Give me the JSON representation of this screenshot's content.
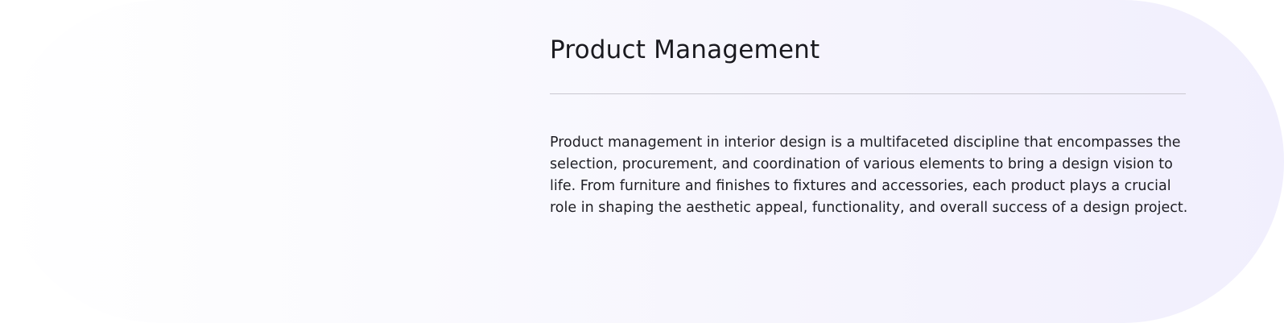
{
  "section": {
    "title": "Product Management",
    "description": "Product management in interior design is a multifaceted discipline that encompasses the selection, procurement, and coordination of various elements to bring a design vision to life. From furniture and finishes to fixtures and accessories, each product plays a crucial role in shaping the aesthetic appeal, functionality, and overall success of a design project."
  },
  "colors": {
    "background_start": "#ffffff",
    "background_end": "#f1effd",
    "text": "#1a1a1f",
    "divider": "#c9c8d0"
  }
}
